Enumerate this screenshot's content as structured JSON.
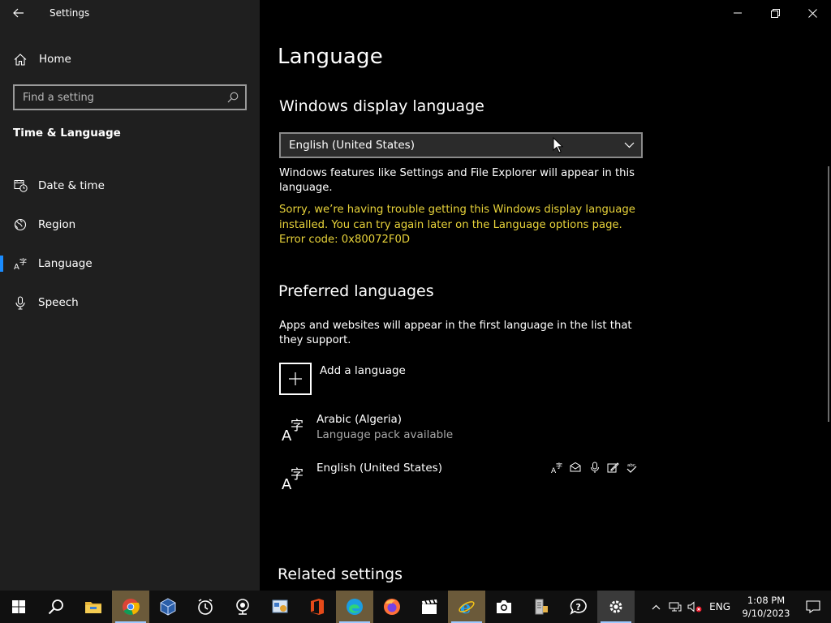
{
  "window": {
    "title": "Settings"
  },
  "sidebar": {
    "home_label": "Home",
    "search_placeholder": "Find a setting",
    "section_title": "Time & Language",
    "items": [
      {
        "label": "Date & time",
        "icon": "calendar-clock-icon"
      },
      {
        "label": "Region",
        "icon": "globe-icon"
      },
      {
        "label": "Language",
        "icon": "language-icon",
        "selected": true
      },
      {
        "label": "Speech",
        "icon": "microphone-icon"
      }
    ]
  },
  "main": {
    "title": "Language",
    "display_language": {
      "heading": "Windows display language",
      "selected": "English (United States)",
      "description": "Windows features like Settings and File Explorer will appear in this language.",
      "error": "Sorry, we’re having trouble getting this Windows display language installed. You can try again later on the Language options page. Error code: 0x80072F0D"
    },
    "preferred": {
      "heading": "Preferred languages",
      "description": "Apps and websites will appear in the first language in the list that they support.",
      "add_label": "Add a language",
      "languages": [
        {
          "name": "Arabic (Algeria)",
          "status": "Language pack available"
        },
        {
          "name": "English (United States)",
          "status": ""
        }
      ]
    },
    "related": {
      "heading": "Related settings"
    }
  },
  "taskbar": {
    "language": "ENG",
    "time": "1:08 PM",
    "date": "9/10/2023"
  },
  "colors": {
    "accent": "#1a8cff",
    "error_text": "#e8d33a",
    "sidebar_bg": "#1f1f1f",
    "content_bg": "#000000"
  }
}
